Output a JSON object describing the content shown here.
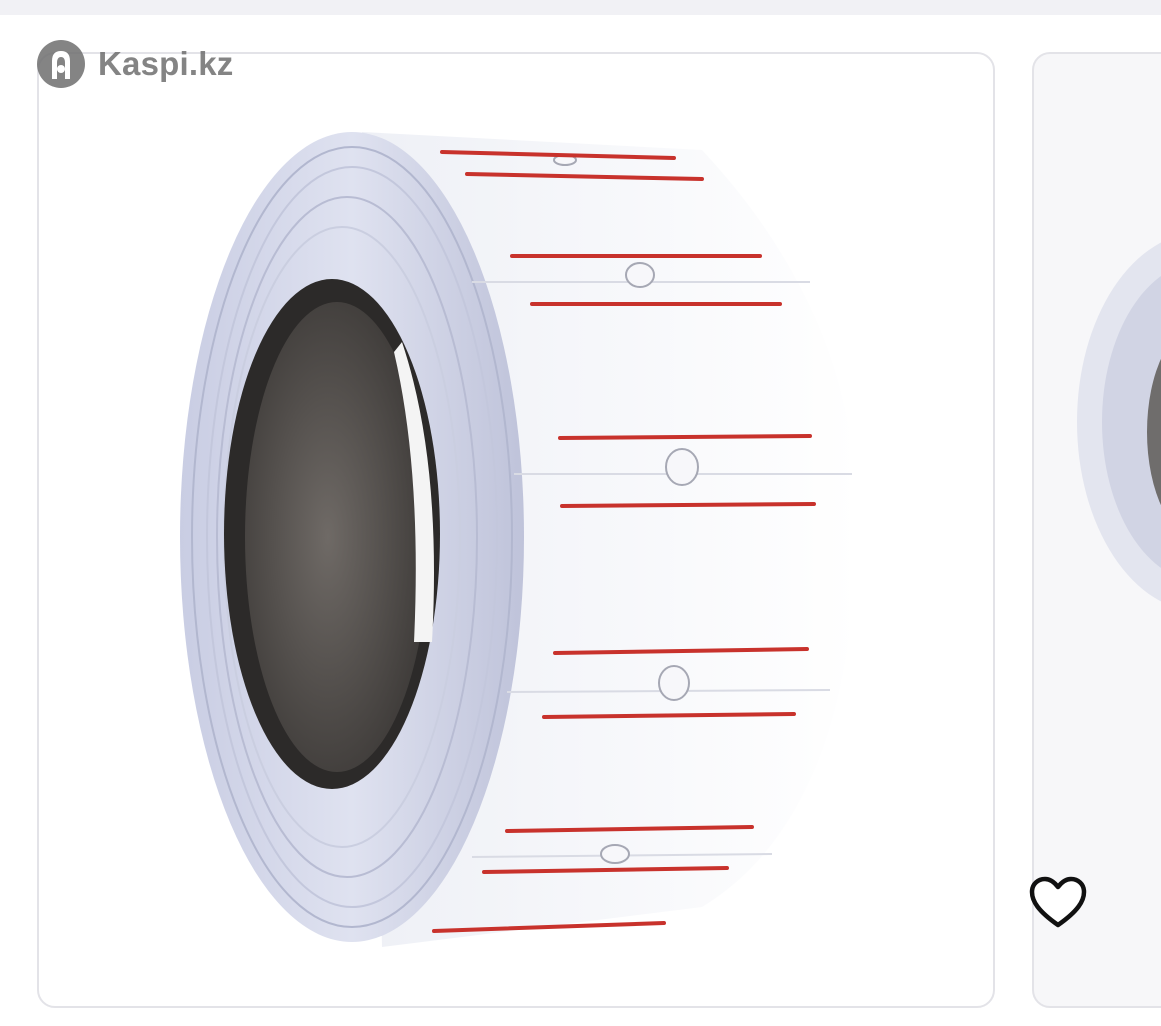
{
  "brand": {
    "name": "Kaspi.kz",
    "logo_icon": "kaspi-logo-icon"
  },
  "gallery": {
    "image_subject": "price-label-roll",
    "label_line_color": "#c8322c",
    "next_image_subject": "price-label-roll"
  },
  "actions": {
    "favorite_icon": "heart-outline-icon"
  }
}
